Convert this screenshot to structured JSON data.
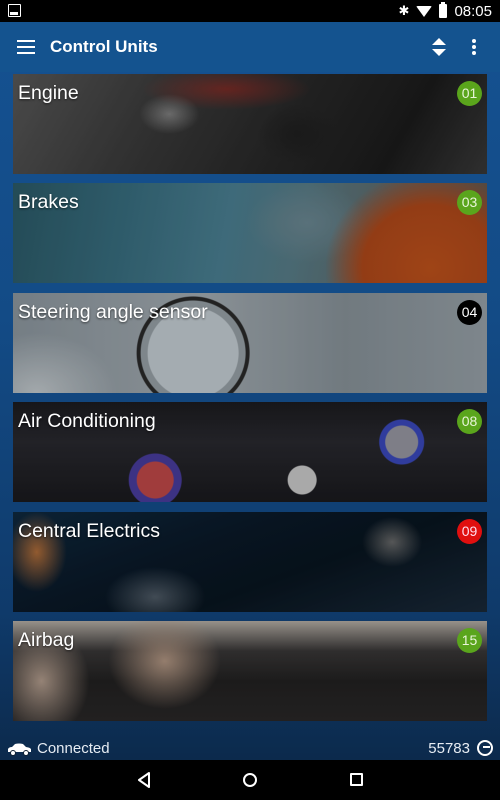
{
  "status_bar": {
    "time": "08:05",
    "icons": [
      "image-notification-icon",
      "bluetooth-icon",
      "wifi-icon",
      "battery-icon"
    ]
  },
  "app_bar": {
    "title": "Control Units",
    "actions": [
      "menu-icon",
      "sort-icon",
      "more-options-icon"
    ]
  },
  "control_units": [
    {
      "label": "Engine",
      "code": "01",
      "status": "ok",
      "badge_color": "#5aa51c",
      "image": "engine-bay"
    },
    {
      "label": "Brakes",
      "code": "03",
      "status": "ok",
      "badge_color": "#5aa51c",
      "image": "brake-unit"
    },
    {
      "label": "Steering angle sensor",
      "code": "04",
      "status": "unknown",
      "badge_color": "#000000",
      "image": "steering-sensor"
    },
    {
      "label": "Air Conditioning",
      "code": "08",
      "status": "ok",
      "badge_color": "#5aa51c",
      "image": "climate-panel"
    },
    {
      "label": "Central Electrics",
      "code": "09",
      "status": "error",
      "badge_color": "#e00f0f",
      "image": "electrics-xray"
    },
    {
      "label": "Airbag",
      "code": "15",
      "status": "ok",
      "badge_color": "#5aa51c",
      "image": "airbags"
    }
  ],
  "footer": {
    "connection_status": "Connected",
    "counter": "55783"
  },
  "nav_bar": {
    "buttons": [
      "back",
      "home",
      "recents"
    ]
  }
}
